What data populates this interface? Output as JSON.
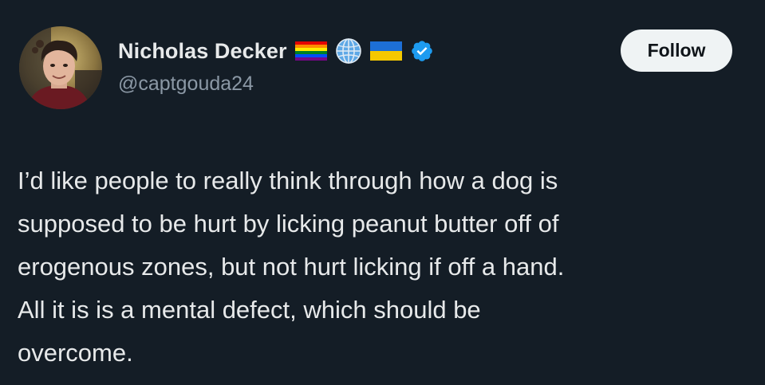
{
  "author": {
    "display_name": "Nicholas Decker",
    "handle": "@captgouda24",
    "name_badges": [
      "rainbow-flag-icon",
      "globe-icon",
      "ukraine-flag-icon",
      "verified-badge-icon"
    ]
  },
  "actions": {
    "follow_label": "Follow"
  },
  "tweet": {
    "lines": [
      "I’d like people to really think through how a dog is",
      "supposed to be hurt by licking peanut butter off of",
      "erogenous zones, but not hurt licking if off a hand.",
      "All it is is a mental defect, which should be",
      "overcome."
    ]
  },
  "colors": {
    "background": "#141d26",
    "text_primary": "#e7e9ea",
    "text_secondary": "#8b98a5",
    "verified_blue": "#1d9bf0",
    "follow_button_bg": "#eff3f4"
  }
}
